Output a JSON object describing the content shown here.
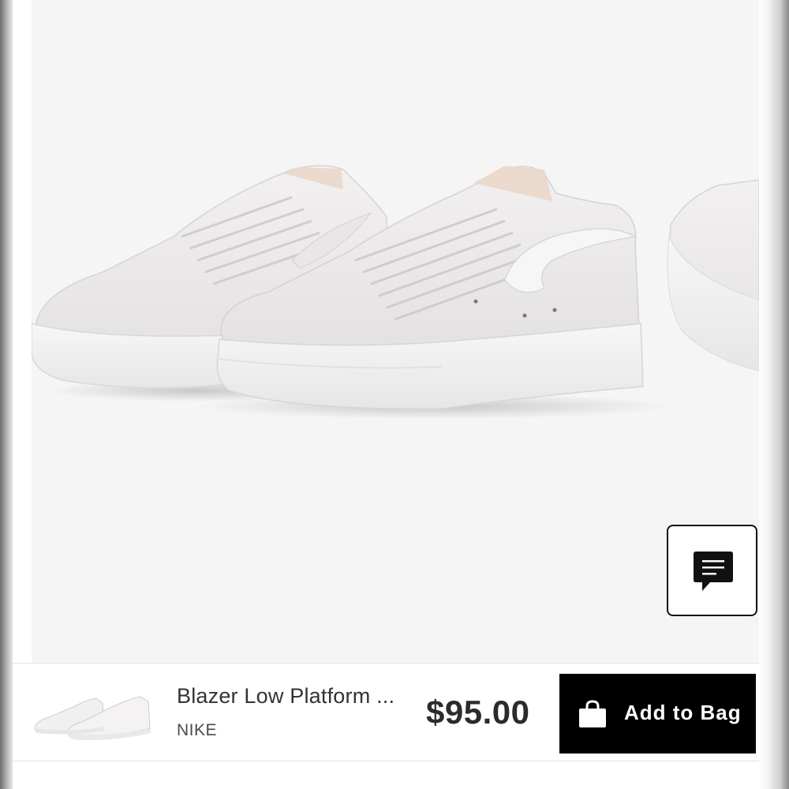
{
  "product": {
    "name": "Blazer Low Platform ...",
    "brand": "NIKE",
    "price": "$95.00"
  },
  "actions": {
    "add_to_bag_label": "Add to Bag"
  },
  "icons": {
    "chat": "chat-bubble-icon",
    "bag": "shopping-bag-icon"
  },
  "colors": {
    "button_bg": "#000000",
    "button_text": "#ffffff",
    "gallery_bg": "#f5f5f5"
  }
}
